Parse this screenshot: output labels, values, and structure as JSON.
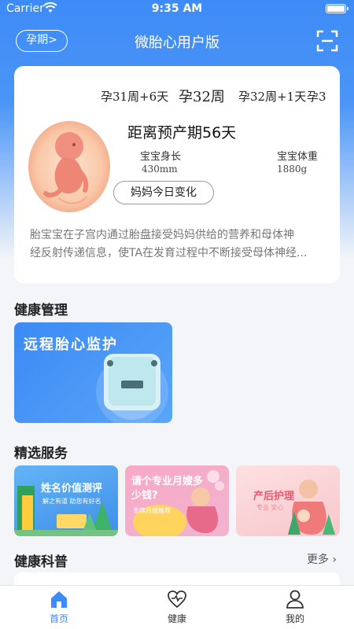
{
  "status_bar": {
    "carrier": "Carrier",
    "time": "9:35 AM"
  },
  "nav": {
    "period_button": "孕期>",
    "title": "微胎心用户版",
    "scan_icon": "scan-icon"
  },
  "pregnancy": {
    "weeks": [
      "孕31周+6天",
      "孕32周",
      "孕32周+1天",
      "孕3"
    ],
    "selected_week": "孕32周",
    "due_text": "距离预产期56天",
    "baby_length_label": "宝宝身长",
    "baby_length_value": "430mm",
    "baby_weight_label": "宝宝体重",
    "baby_weight_value": "1880g",
    "mama_button": "妈妈今日变化",
    "description_line1": "胎宝宝在子宫内通过胎盘接受妈妈供给的营养和母体神",
    "description_line2": "经反射传递信息，使TA在发育过程中不断接受母体神经..."
  },
  "health_management": {
    "title": "健康管理",
    "monitor_title": "远程胎心监护"
  },
  "services": {
    "title": "精选服务",
    "items": [
      {
        "title": "姓名价值测评",
        "subtitle": "解之有道 助您有好名",
        "color": "#4fa7f2"
      },
      {
        "title": "请个专业月嫂多少钱?",
        "subtitle": "金牌月嫂推荐",
        "color": "#f39ab6"
      },
      {
        "title": "产后护理",
        "subtitle": "专业 安心",
        "color": "#f7c6c9"
      }
    ]
  },
  "health_science": {
    "title": "健康科普",
    "more": "更多"
  },
  "tabbar": {
    "items": [
      {
        "label": "首页",
        "icon": "home-icon",
        "active": true
      },
      {
        "label": "健康",
        "icon": "heart-pulse-icon",
        "active": false
      },
      {
        "label": "我的",
        "icon": "person-icon",
        "active": false
      }
    ]
  },
  "colors": {
    "primary": "#3d8bf7",
    "background": "#f3f5f9"
  }
}
